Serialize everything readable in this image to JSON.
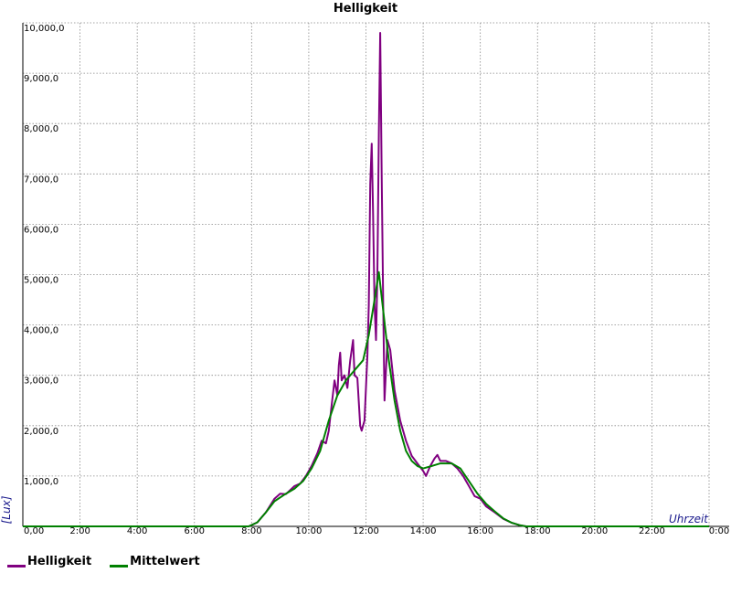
{
  "chart_data": {
    "type": "line",
    "title": "Helligkeit",
    "xlabel": "Uhrzeit",
    "ylabel": "[Lux]",
    "xlim": [
      0,
      24
    ],
    "ylim": [
      0,
      10000
    ],
    "grid": true,
    "legend_position": "bottom-left",
    "x_ticks": [
      "0,00",
      "2:00",
      "4:00",
      "6:00",
      "8:00",
      "10:00",
      "12:00",
      "14:00",
      "16:00",
      "18:00",
      "20:00",
      "22:00",
      "0:00"
    ],
    "y_ticks": [
      "1,000,0",
      "2,000,0",
      "3,000,0",
      "4,000,0",
      "5,000,0",
      "6,000,0",
      "7,000,0",
      "8,000,0",
      "9,000,0",
      "10,000,0"
    ],
    "series": [
      {
        "name": "Helligkeit",
        "color": "#800080",
        "points": [
          [
            0,
            0
          ],
          [
            7.9,
            0
          ],
          [
            8.2,
            80
          ],
          [
            8.5,
            280
          ],
          [
            8.8,
            550
          ],
          [
            9.0,
            650
          ],
          [
            9.2,
            640
          ],
          [
            9.5,
            800
          ],
          [
            9.7,
            850
          ],
          [
            9.9,
            1000
          ],
          [
            10.1,
            1200
          ],
          [
            10.3,
            1450
          ],
          [
            10.45,
            1700
          ],
          [
            10.6,
            1650
          ],
          [
            10.7,
            1900
          ],
          [
            10.8,
            2400
          ],
          [
            10.9,
            2900
          ],
          [
            11.0,
            2600
          ],
          [
            11.05,
            3200
          ],
          [
            11.1,
            3450
          ],
          [
            11.15,
            2900
          ],
          [
            11.25,
            3000
          ],
          [
            11.35,
            2750
          ],
          [
            11.45,
            3300
          ],
          [
            11.55,
            3700
          ],
          [
            11.6,
            3000
          ],
          [
            11.7,
            2950
          ],
          [
            11.8,
            2000
          ],
          [
            11.85,
            1900
          ],
          [
            11.95,
            2100
          ],
          [
            12.05,
            3400
          ],
          [
            12.1,
            4400
          ],
          [
            12.15,
            6800
          ],
          [
            12.2,
            7600
          ],
          [
            12.25,
            6200
          ],
          [
            12.3,
            4400
          ],
          [
            12.35,
            3700
          ],
          [
            12.4,
            5000
          ],
          [
            12.45,
            7800
          ],
          [
            12.5,
            9800
          ],
          [
            12.55,
            7000
          ],
          [
            12.6,
            4500
          ],
          [
            12.65,
            2500
          ],
          [
            12.75,
            3700
          ],
          [
            12.85,
            3500
          ],
          [
            13.0,
            2700
          ],
          [
            13.2,
            2100
          ],
          [
            13.4,
            1700
          ],
          [
            13.6,
            1400
          ],
          [
            13.8,
            1250
          ],
          [
            14.0,
            1100
          ],
          [
            14.1,
            1000
          ],
          [
            14.25,
            1200
          ],
          [
            14.4,
            1350
          ],
          [
            14.5,
            1420
          ],
          [
            14.6,
            1300
          ],
          [
            14.8,
            1300
          ],
          [
            15.0,
            1250
          ],
          [
            15.2,
            1150
          ],
          [
            15.4,
            1000
          ],
          [
            15.6,
            800
          ],
          [
            15.8,
            600
          ],
          [
            16.0,
            550
          ],
          [
            16.2,
            400
          ],
          [
            16.5,
            280
          ],
          [
            16.8,
            150
          ],
          [
            17.1,
            70
          ],
          [
            17.4,
            20
          ],
          [
            17.6,
            0
          ],
          [
            24,
            0
          ]
        ]
      },
      {
        "name": "Mittelwert",
        "color": "#008000",
        "points": [
          [
            0,
            0
          ],
          [
            7.9,
            0
          ],
          [
            8.2,
            80
          ],
          [
            8.5,
            280
          ],
          [
            8.8,
            500
          ],
          [
            9.2,
            650
          ],
          [
            9.5,
            750
          ],
          [
            9.8,
            900
          ],
          [
            10.1,
            1150
          ],
          [
            10.4,
            1500
          ],
          [
            10.7,
            2100
          ],
          [
            11.0,
            2600
          ],
          [
            11.3,
            2900
          ],
          [
            11.6,
            3100
          ],
          [
            11.9,
            3300
          ],
          [
            12.1,
            3800
          ],
          [
            12.3,
            4500
          ],
          [
            12.45,
            5050
          ],
          [
            12.6,
            4300
          ],
          [
            12.8,
            3300
          ],
          [
            13.0,
            2500
          ],
          [
            13.2,
            1900
          ],
          [
            13.4,
            1500
          ],
          [
            13.6,
            1300
          ],
          [
            13.8,
            1200
          ],
          [
            14.0,
            1150
          ],
          [
            14.3,
            1200
          ],
          [
            14.6,
            1250
          ],
          [
            15.0,
            1250
          ],
          [
            15.3,
            1150
          ],
          [
            15.6,
            900
          ],
          [
            15.9,
            650
          ],
          [
            16.2,
            450
          ],
          [
            16.5,
            300
          ],
          [
            16.8,
            160
          ],
          [
            17.1,
            70
          ],
          [
            17.4,
            20
          ],
          [
            17.6,
            0
          ],
          [
            24,
            0
          ]
        ]
      }
    ]
  }
}
